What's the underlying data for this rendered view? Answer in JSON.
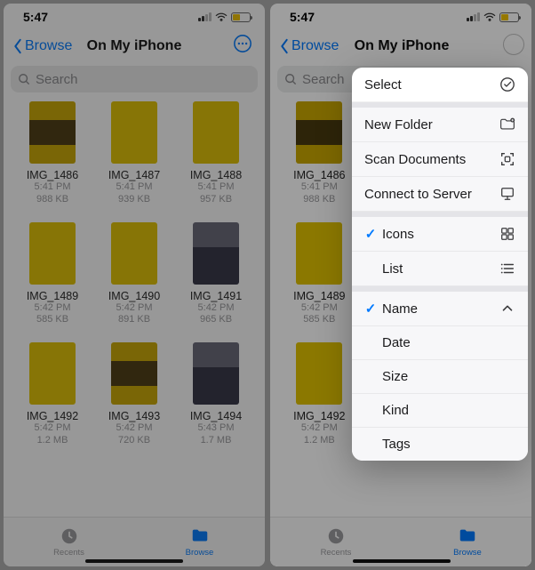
{
  "statusbar": {
    "time": "5:47"
  },
  "navbar": {
    "back": "Browse",
    "title": "On My iPhone"
  },
  "search": {
    "placeholder": "Search"
  },
  "files": [
    {
      "name": "IMG_1486",
      "time": "5:41 PM",
      "size": "988 KB",
      "thumb": "inner1"
    },
    {
      "name": "IMG_1487",
      "time": "5:41 PM",
      "size": "939 KB",
      "thumb": "inner2"
    },
    {
      "name": "IMG_1488",
      "time": "5:41 PM",
      "size": "957 KB",
      "thumb": "inner2"
    },
    {
      "name": "IMG_1489",
      "time": "5:42 PM",
      "size": "585 KB",
      "thumb": "inner2"
    },
    {
      "name": "IMG_1490",
      "time": "5:42 PM",
      "size": "891 KB",
      "thumb": "inner2"
    },
    {
      "name": "IMG_1491",
      "time": "5:42 PM",
      "size": "965 KB",
      "thumb": "innerdark"
    },
    {
      "name": "IMG_1492",
      "time": "5:42 PM",
      "size": "1.2 MB",
      "thumb": "inner2"
    },
    {
      "name": "IMG_1493",
      "time": "5:42 PM",
      "size": "720 KB",
      "thumb": "inner1"
    },
    {
      "name": "IMG_1494",
      "time": "5:43 PM",
      "size": "1.7 MB",
      "thumb": "innerdark"
    }
  ],
  "tabs": {
    "recents": "Recents",
    "browse": "Browse"
  },
  "menu": {
    "select": "Select",
    "new_folder": "New Folder",
    "scan_documents": "Scan Documents",
    "connect_server": "Connect to Server",
    "icons": "Icons",
    "list": "List",
    "name": "Name",
    "date": "Date",
    "size": "Size",
    "kind": "Kind",
    "tags": "Tags"
  }
}
